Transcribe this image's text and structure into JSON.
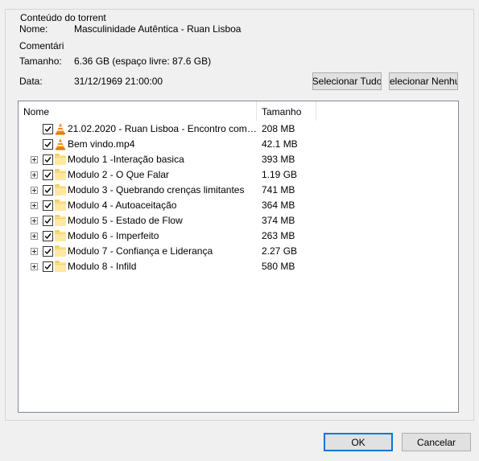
{
  "group_title": "Conteúdo do torrent",
  "info": {
    "name_label": "Nome:",
    "name_value": "Masculinidade Autêntica - Ruan Lisboa",
    "comment_label": "Comentári",
    "size_label": "Tamanho:",
    "size_value": "6.36 GB (espaço livre: 87.6 GB)",
    "date_label": "Data:",
    "date_value": "31/12/1969 21:00:00"
  },
  "buttons": {
    "select_all": "Selecionar Tudo",
    "select_none": "elecionar Nenhu",
    "ok": "OK",
    "cancel": "Cancelar"
  },
  "columns": {
    "name": "Nome",
    "size": "Tamanho"
  },
  "files": [
    {
      "name": "21.02.2020 - Ruan Lisboa - Encontro com a...",
      "size": "208 MB",
      "icon": "vlc-cone-icon",
      "expandable": false,
      "checked": true
    },
    {
      "name": "Bem vindo.mp4",
      "size": "42.1 MB",
      "icon": "vlc-cone-icon",
      "expandable": false,
      "checked": true
    },
    {
      "name": "Modulo 1 -Interação basica",
      "size": "393 MB",
      "icon": "folder-icon",
      "expandable": true,
      "checked": true
    },
    {
      "name": "Modulo 2 - O Que Falar",
      "size": "1.19 GB",
      "icon": "folder-icon",
      "expandable": true,
      "checked": true
    },
    {
      "name": "Modulo 3 - Quebrando crenças limitantes",
      "size": "741 MB",
      "icon": "folder-icon",
      "expandable": true,
      "checked": true
    },
    {
      "name": "Modulo 4 - Autoaceitação",
      "size": "364 MB",
      "icon": "folder-icon",
      "expandable": true,
      "checked": true
    },
    {
      "name": "Modulo 5 - Estado de Flow",
      "size": "374 MB",
      "icon": "folder-icon",
      "expandable": true,
      "checked": true
    },
    {
      "name": "Modulo 6 - Imperfeito",
      "size": "263 MB",
      "icon": "folder-icon",
      "expandable": true,
      "checked": true
    },
    {
      "name": "Modulo 7 - Confiança e Liderança",
      "size": "2.27 GB",
      "icon": "folder-icon",
      "expandable": true,
      "checked": true
    },
    {
      "name": "Modulo 8 - Infild",
      "size": "580 MB",
      "icon": "folder-icon",
      "expandable": true,
      "checked": true
    }
  ]
}
